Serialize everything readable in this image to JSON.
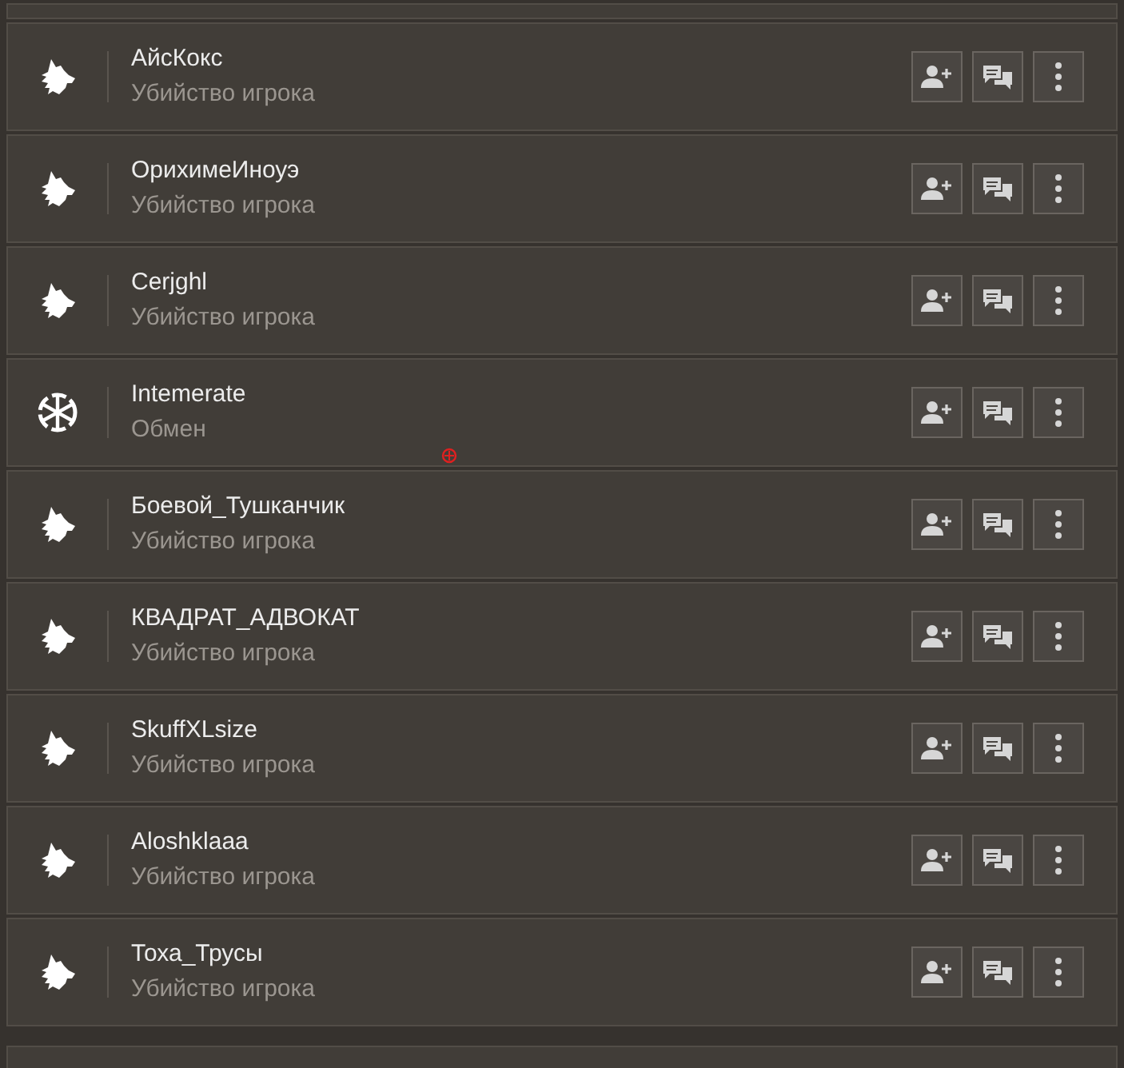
{
  "entries": [
    {
      "name": "АйсКокс",
      "event": "Убийство игрока",
      "kind": "wolf"
    },
    {
      "name": "ОрихимеИноуэ",
      "event": "Убийство игрока",
      "kind": "wolf"
    },
    {
      "name": "Cerjghl",
      "event": "Убийство игрока",
      "kind": "wolf"
    },
    {
      "name": "Intemerate",
      "event": "Обмен",
      "kind": "emblem"
    },
    {
      "name": "Боевой_Тушканчик",
      "event": "Убийство игрока",
      "kind": "wolf"
    },
    {
      "name": "КВАДРАТ_АДВОКАТ",
      "event": "Убийство игрока",
      "kind": "wolf"
    },
    {
      "name": "SkuffXLsize",
      "event": "Убийство игрока",
      "kind": "wolf"
    },
    {
      "name": "Aloshklaaa",
      "event": "Убийство игрока",
      "kind": "wolf"
    },
    {
      "name": "Тоха_Трусы",
      "event": "Убийство игрока",
      "kind": "wolf"
    }
  ]
}
